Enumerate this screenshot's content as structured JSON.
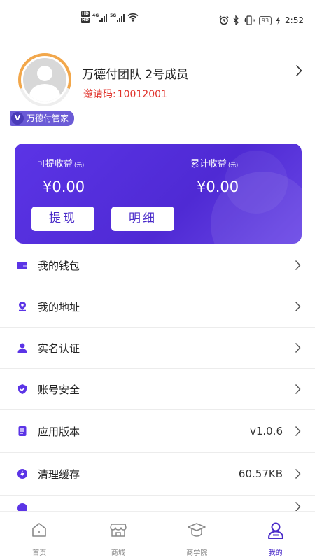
{
  "status_bar": {
    "hd_top": "HD",
    "hd_bottom": "HD",
    "net1": "4G",
    "net2": "5G",
    "battery": "93",
    "time": "2:52"
  },
  "profile": {
    "name": "万德付团队 2号成员",
    "invite_label": "邀请码:",
    "invite_code": "10012001",
    "role_badge": "万德付管家",
    "role_icon_letter": "V"
  },
  "earnings": {
    "withdrawable_label": "可提收益",
    "withdrawable_unit": "(元)",
    "withdrawable_value": "¥0.00",
    "total_label": "累计收益",
    "total_unit": "(元)",
    "total_value": "¥0.00",
    "withdraw_button": "提现",
    "detail_button": "明细",
    "accent_color": "#5b34e6"
  },
  "menu": {
    "items": [
      {
        "label": "我的钱包",
        "icon": "wallet-icon",
        "value": ""
      },
      {
        "label": "我的地址",
        "icon": "location-pin-icon",
        "value": ""
      },
      {
        "label": "实名认证",
        "icon": "user-verify-icon",
        "value": ""
      },
      {
        "label": "账号安全",
        "icon": "shield-check-icon",
        "value": ""
      },
      {
        "label": "应用版本",
        "icon": "document-icon",
        "value": "v1.0.6"
      },
      {
        "label": "清理缓存",
        "icon": "lightning-icon",
        "value": "60.57KB"
      }
    ]
  },
  "tabbar": {
    "tabs": [
      {
        "label": "首页",
        "icon": "home-icon",
        "active": false
      },
      {
        "label": "商城",
        "icon": "shop-icon",
        "active": false
      },
      {
        "label": "商学院",
        "icon": "graduation-cap-icon",
        "active": false
      },
      {
        "label": "我的",
        "icon": "user-icon",
        "active": true
      }
    ],
    "active_color": "#4a2bc9",
    "inactive_color": "#888888"
  }
}
